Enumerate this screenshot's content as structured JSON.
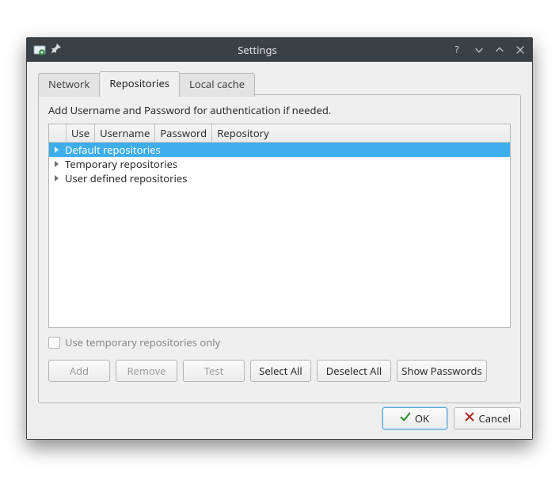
{
  "window": {
    "title": "Settings"
  },
  "tabs": {
    "network": "Network",
    "repositories": "Repositories",
    "localcache": "Local cache",
    "active": "repositories"
  },
  "panel": {
    "hint": "Add Username and Password for authentication if needed.",
    "columns": {
      "use": "Use",
      "username": "Username",
      "password": "Password",
      "repository": "Repository"
    },
    "groups": [
      {
        "label": "Default repositories",
        "selected": true
      },
      {
        "label": "Temporary repositories",
        "selected": false
      },
      {
        "label": "User defined repositories",
        "selected": false
      }
    ],
    "checkbox": {
      "label": "Use temporary repositories only",
      "checked": false
    },
    "buttons": {
      "add": "Add",
      "remove": "Remove",
      "test": "Test",
      "selectAll": "Select All",
      "deselectAll": "Deselect All",
      "showPasswords": "Show Passwords"
    }
  },
  "dialog": {
    "ok": "OK",
    "cancel": "Cancel"
  }
}
